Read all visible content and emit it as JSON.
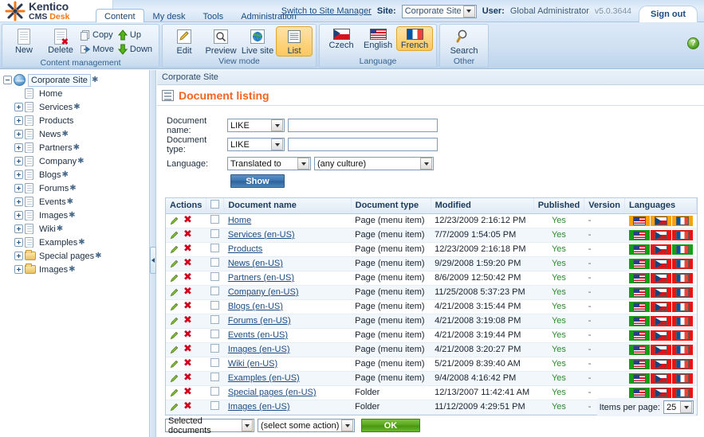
{
  "app": {
    "logo_name": "Kentico",
    "logo_cms": "CMS",
    "logo_desk": "Desk"
  },
  "header": {
    "tabs": [
      {
        "label": "Content",
        "active": true
      },
      {
        "label": "My desk",
        "active": false
      },
      {
        "label": "Tools",
        "active": false
      },
      {
        "label": "Administration",
        "active": false
      }
    ],
    "switch_link": "Switch to Site Manager",
    "site_label": "Site:",
    "site_value": "Corporate Site",
    "user_label": "User:",
    "user_value": "Global Administrator",
    "version": "v5.0.3644",
    "signout": "Sign out"
  },
  "ribbon": {
    "groups": [
      {
        "title": "Content management",
        "big": [
          {
            "label": "New",
            "icon": "new-document-icon"
          },
          {
            "label": "Delete",
            "icon": "delete-document-icon"
          }
        ],
        "small": [
          {
            "label": "Copy",
            "icon": "copy-icon"
          },
          {
            "label": "Move",
            "icon": "move-icon"
          },
          {
            "label": "Up",
            "icon": "arrow-up-icon"
          },
          {
            "label": "Down",
            "icon": "arrow-down-icon"
          }
        ]
      },
      {
        "title": "View mode",
        "big": [
          {
            "label": "Edit",
            "icon": "edit-pencil-icon",
            "selected": false
          },
          {
            "label": "Preview",
            "icon": "preview-magnifier-icon",
            "selected": false
          },
          {
            "label": "Live site",
            "icon": "live-site-globe-icon",
            "selected": false
          },
          {
            "label": "List",
            "icon": "list-icon",
            "selected": true
          }
        ],
        "small": []
      },
      {
        "title": "Language",
        "big": [
          {
            "label": "Czech",
            "icon": "flag-cz-icon",
            "selected": false
          },
          {
            "label": "English",
            "icon": "flag-us-icon",
            "selected": false
          },
          {
            "label": "French",
            "icon": "flag-fr-icon",
            "selected": true
          }
        ],
        "small": []
      },
      {
        "title": "Other",
        "big": [
          {
            "label": "Search",
            "icon": "search-magnifier-icon",
            "selected": false
          }
        ],
        "small": []
      }
    ]
  },
  "tree": {
    "root": {
      "label": "Corporate Site",
      "star": true,
      "icon": "globe-icon"
    },
    "items": [
      {
        "label": "Home",
        "star": false,
        "icon": "page-icon",
        "expandable": false
      },
      {
        "label": "Services",
        "star": true,
        "icon": "page-icon",
        "expandable": true
      },
      {
        "label": "Products",
        "star": false,
        "icon": "page-icon",
        "expandable": true
      },
      {
        "label": "News",
        "star": true,
        "icon": "page-icon",
        "expandable": true
      },
      {
        "label": "Partners",
        "star": true,
        "icon": "page-icon",
        "expandable": true
      },
      {
        "label": "Company",
        "star": true,
        "icon": "page-icon",
        "expandable": true
      },
      {
        "label": "Blogs",
        "star": true,
        "icon": "page-icon",
        "expandable": true
      },
      {
        "label": "Forums",
        "star": true,
        "icon": "page-icon",
        "expandable": true
      },
      {
        "label": "Events",
        "star": true,
        "icon": "page-icon",
        "expandable": true
      },
      {
        "label": "Images",
        "star": true,
        "icon": "page-icon",
        "expandable": true
      },
      {
        "label": "Wiki",
        "star": true,
        "icon": "page-icon",
        "expandable": true
      },
      {
        "label": "Examples",
        "star": true,
        "icon": "page-icon",
        "expandable": true
      },
      {
        "label": "Special pages",
        "star": true,
        "icon": "folder-icon",
        "expandable": true
      },
      {
        "label": "Images",
        "star": true,
        "icon": "folder-icon",
        "expandable": true
      }
    ]
  },
  "content": {
    "breadcrumb": "Corporate Site",
    "page_title": "Document listing",
    "help_label": "?"
  },
  "filter": {
    "doc_name_label": "Document name:",
    "doc_name_op": "LIKE",
    "doc_name_value": "",
    "doc_type_label": "Document type:",
    "doc_type_op": "LIKE",
    "doc_type_value": "",
    "language_label": "Language:",
    "language_op": "Translated to",
    "language_culture": "(any culture)",
    "show_button": "Show"
  },
  "table": {
    "columns": [
      "Actions",
      "",
      "Document name",
      "Document type",
      "Modified",
      "Published",
      "Version",
      "Languages"
    ],
    "rows": [
      {
        "name": "Home",
        "type": "Page (menu item)",
        "modified": "12/23/2009 2:16:12 PM",
        "published": "Yes",
        "version": "-",
        "langs": [
          "orange",
          "orange",
          "orange"
        ]
      },
      {
        "name": "Services (en-US)",
        "type": "Page (menu item)",
        "modified": "7/7/2009 1:54:05 PM",
        "published": "Yes",
        "version": "-",
        "langs": [
          "green",
          "red",
          "red"
        ]
      },
      {
        "name": "Products",
        "type": "Page (menu item)",
        "modified": "12/23/2009 2:16:18 PM",
        "published": "Yes",
        "version": "-",
        "langs": [
          "green",
          "red",
          "green"
        ]
      },
      {
        "name": "News (en-US)",
        "type": "Page (menu item)",
        "modified": "9/29/2008 1:59:20 PM",
        "published": "Yes",
        "version": "-",
        "langs": [
          "green",
          "red",
          "red"
        ]
      },
      {
        "name": "Partners (en-US)",
        "type": "Page (menu item)",
        "modified": "8/6/2009 12:50:42 PM",
        "published": "Yes",
        "version": "-",
        "langs": [
          "green",
          "red",
          "red"
        ]
      },
      {
        "name": "Company (en-US)",
        "type": "Page (menu item)",
        "modified": "11/25/2008 5:37:23 PM",
        "published": "Yes",
        "version": "-",
        "langs": [
          "green",
          "red",
          "red"
        ]
      },
      {
        "name": "Blogs (en-US)",
        "type": "Page (menu item)",
        "modified": "4/21/2008 3:15:44 PM",
        "published": "Yes",
        "version": "-",
        "langs": [
          "green",
          "red",
          "red"
        ]
      },
      {
        "name": "Forums (en-US)",
        "type": "Page (menu item)",
        "modified": "4/21/2008 3:19:08 PM",
        "published": "Yes",
        "version": "-",
        "langs": [
          "green",
          "red",
          "red"
        ]
      },
      {
        "name": "Events (en-US)",
        "type": "Page (menu item)",
        "modified": "4/21/2008 3:19:44 PM",
        "published": "Yes",
        "version": "-",
        "langs": [
          "green",
          "red",
          "red"
        ]
      },
      {
        "name": "Images (en-US)",
        "type": "Page (menu item)",
        "modified": "4/21/2008 3:20:27 PM",
        "published": "Yes",
        "version": "-",
        "langs": [
          "green",
          "red",
          "red"
        ]
      },
      {
        "name": "Wiki (en-US)",
        "type": "Page (menu item)",
        "modified": "5/21/2009 8:39:40 AM",
        "published": "Yes",
        "version": "-",
        "langs": [
          "green",
          "red",
          "red"
        ]
      },
      {
        "name": "Examples (en-US)",
        "type": "Page (menu item)",
        "modified": "9/4/2008 4:16:42 PM",
        "published": "Yes",
        "version": "-",
        "langs": [
          "green",
          "red",
          "red"
        ]
      },
      {
        "name": "Special pages (en-US)",
        "type": "Folder",
        "modified": "12/13/2007 11:42:41 AM",
        "published": "Yes",
        "version": "-",
        "langs": [
          "green",
          "red",
          "red"
        ]
      },
      {
        "name": "Images (en-US)",
        "type": "Folder",
        "modified": "11/12/2009 4:29:51 PM",
        "published": "Yes",
        "version": "-",
        "langs": [
          "green",
          "red",
          "red"
        ]
      }
    ]
  },
  "footer": {
    "items_per_page_label": "Items per page:",
    "items_per_page_value": "25",
    "scope_select": "Selected documents",
    "action_select": "(select some action)",
    "ok_button": "OK"
  },
  "colors": {
    "accent_orange": "#f26522",
    "link_blue": "#1b4b82",
    "published_green": "#2e8b2e",
    "lang_green": "#14a014",
    "lang_red": "#ee1111",
    "lang_orange": "#f5a210"
  }
}
